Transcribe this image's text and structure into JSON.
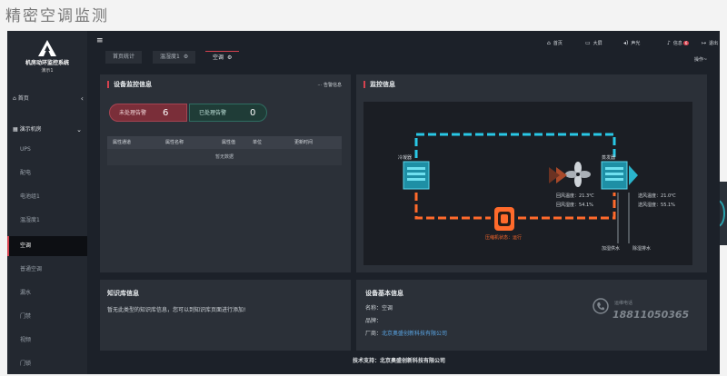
{
  "banner": {
    "title": "精密空调监测"
  },
  "logo": {
    "name": "机房动环监控系统",
    "sub": "演示1"
  },
  "sidebar": {
    "home": "首页",
    "group": "演示机房",
    "items": [
      "UPS",
      "配电",
      "电池组1",
      "温湿度1",
      "空调",
      "普通空调",
      "漏水",
      "门禁",
      "视频",
      "门锁"
    ]
  },
  "topbar": {
    "tabs": [
      "首页统计",
      "温湿度1",
      "空调"
    ],
    "actions": {
      "home": "首页",
      "bigscreen": "大屏",
      "sound": "声光",
      "info": "信息",
      "info_badge": "6",
      "logout": "退出"
    },
    "ops": "操作~"
  },
  "device_panel": {
    "title": "设备监控信息",
    "alarm_link": "告警信息",
    "unprocessed_label": "未处理告警",
    "unprocessed_count": "6",
    "processed_label": "已处理告警",
    "processed_count": "0",
    "columns": [
      "属性通道",
      "属性名称",
      "属性值",
      "单位",
      "更新时间"
    ],
    "empty": "暂无数据"
  },
  "monitor_panel": {
    "title": "监控信息",
    "condenser": "冷凝器",
    "evaporator": "蒸发器",
    "return_temp_label": "回风温度：",
    "return_temp": "21.3℃",
    "return_hum_label": "回风湿度：",
    "return_hum": "54.1%",
    "supply_temp_label": "送风温度：",
    "supply_temp": "21.0℃",
    "supply_hum_label": "送风湿度：",
    "supply_hum": "55.1%",
    "compressor_label": "压缩机状态：",
    "compressor_state": "运行",
    "humidifier_water": "加湿供水",
    "dehumid_water": "除湿排水"
  },
  "knowledge_panel": {
    "title": "知识库信息",
    "text": "暂无此类型的知识库信息，您可以到知识库页面进行添加!"
  },
  "device_info": {
    "title": "设备基本信息",
    "name_label": "名称：",
    "name_value": "空调",
    "brand_label": "品牌：",
    "brand_value": "",
    "maker_label": "厂商：",
    "maker_value": "北京奥盛创新科技有限公司",
    "phone_label": "运维电话",
    "phone": "18811050365"
  },
  "footer": {
    "text": "技术支持：北京奥盛创新科技有限公司"
  },
  "colors": {
    "accent": "#d5424f",
    "pipe_cold": "#29c8e6",
    "pipe_hot": "#ff6a2b"
  }
}
